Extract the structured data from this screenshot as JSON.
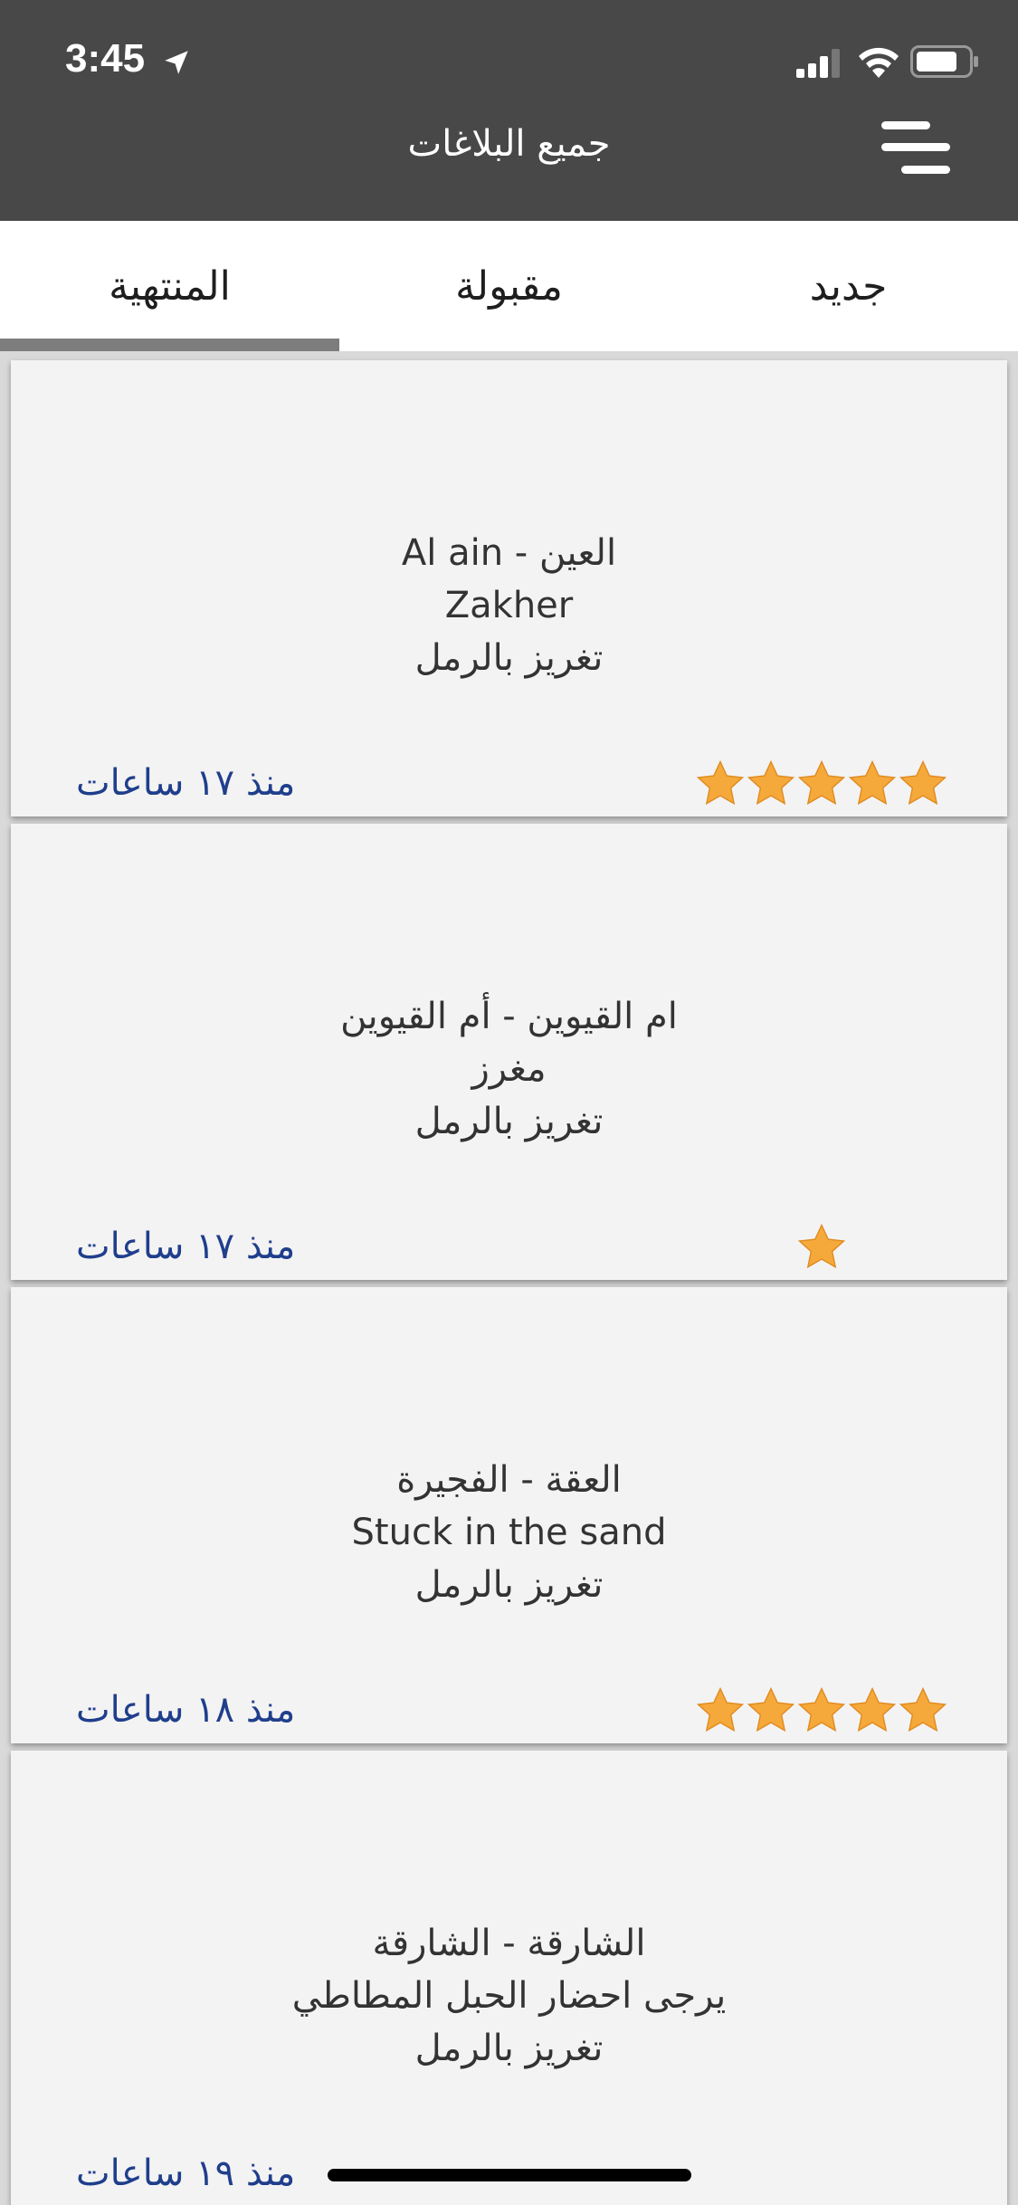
{
  "status_bar": {
    "time": "3:45"
  },
  "header": {
    "title": "جميع البلاغات"
  },
  "tabs": [
    {
      "label": "جديد"
    },
    {
      "label": "مقبولة"
    },
    {
      "label": "المنتهية",
      "active": true
    }
  ],
  "reports": [
    {
      "location": "العين - Al ain",
      "description": "Zakher",
      "service": "تغريز بالرمل",
      "time": "منذ ١٧ ساعات",
      "rating": 5
    },
    {
      "location": "ام القيوين  - أم القيوين",
      "description": "مغرز",
      "service": "تغريز بالرمل",
      "time": "منذ ١٧ ساعات",
      "rating": 1
    },
    {
      "location": "العقة - الفجيرة",
      "description": "Stuck in the sand",
      "service": "تغريز بالرمل",
      "time": "منذ ١٨ ساعات",
      "rating": 5
    },
    {
      "location": "الشارقة - الشارقة",
      "description": "يرجى احضار الحبل المطاطي",
      "service": "تغريز بالرمل",
      "time": "منذ ١٩ ساعات",
      "rating": null
    }
  ],
  "colors": {
    "header_bg": "#484848",
    "time_text": "#1f3e8c",
    "star": "#f6a93b",
    "tab_indicator": "#7d7d7d"
  },
  "icons": {
    "location": "location-arrow-icon",
    "menu": "hamburger-menu-icon",
    "star": "star-icon"
  }
}
